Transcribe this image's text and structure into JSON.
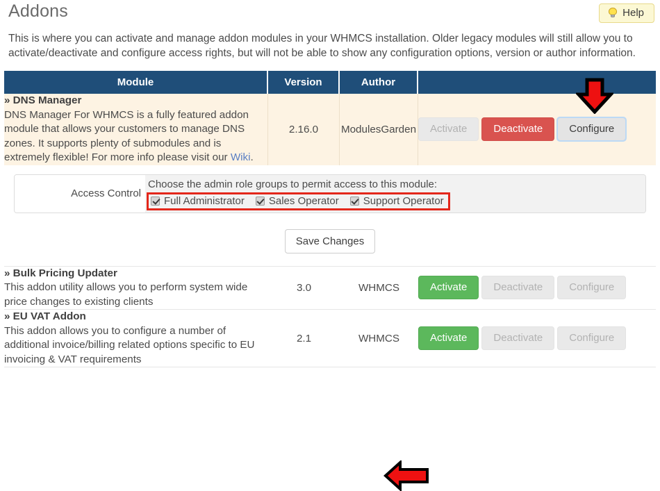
{
  "header": {
    "title": "Addons",
    "help_label": "Help",
    "help_icon": "lightbulb-icon"
  },
  "intro": {
    "line1": "This is where you can activate and manage addon modules in your WHMCS installation. Older legacy modules will still allow you to",
    "line2": "activate/deactivate and configure access rights, but will not be able to show any configuration options, version or author information."
  },
  "table": {
    "columns": {
      "module": "Module",
      "version": "Version",
      "author": "Author",
      "actions": ""
    },
    "rows": [
      {
        "name": "» DNS Manager",
        "description_pre": "DNS Manager For WHMCS is a fully featured addon module that allows your customers to manage DNS zones. It supports plenty of submodules and is extremely flexible! For more info please visit our ",
        "link_text": "Wiki",
        "description_post": ".",
        "version": "2.16.0",
        "author": "ModulesGarden",
        "buttons": {
          "activate": "Activate",
          "deactivate": "Deactivate",
          "configure": "Configure"
        }
      },
      {
        "name": "» Bulk Pricing Updater",
        "description": "This addon utility allows you to perform system wide price changes to existing clients",
        "version": "3.0",
        "author": "WHMCS",
        "buttons": {
          "activate": "Activate",
          "deactivate": "Deactivate",
          "configure": "Configure"
        }
      },
      {
        "name": "» EU VAT Addon",
        "description": "This addon allows you to configure a number of additional invoice/billing related options specific to EU invoicing & VAT requirements",
        "version": "2.1",
        "author": "WHMCS",
        "buttons": {
          "activate": "Activate",
          "deactivate": "Deactivate",
          "configure": "Configure"
        }
      }
    ]
  },
  "access_control": {
    "label": "Access Control",
    "prompt": "Choose the admin role groups to permit access to this module:",
    "options": [
      {
        "label": "Full Administrator",
        "checked": true
      },
      {
        "label": "Sales Operator",
        "checked": true
      },
      {
        "label": "Support Operator",
        "checked": true
      }
    ]
  },
  "save": {
    "label": "Save Changes"
  },
  "annotations": {
    "arrow_down": "red-down-arrow pointing at Configure button",
    "arrow_left": "red-left-arrow pointing at Save Changes button",
    "highlight_box": "red rectangle around the admin role checkboxes"
  },
  "colors": {
    "table_header_bg": "#1f4e79",
    "active_row_bg": "#fdf3e3",
    "activate_green": "#5cb85c",
    "deactivate_red": "#d9534f",
    "annotation_red": "#e3271b",
    "help_bg": "#fcf8d4",
    "link_blue": "#5a7fc4"
  }
}
